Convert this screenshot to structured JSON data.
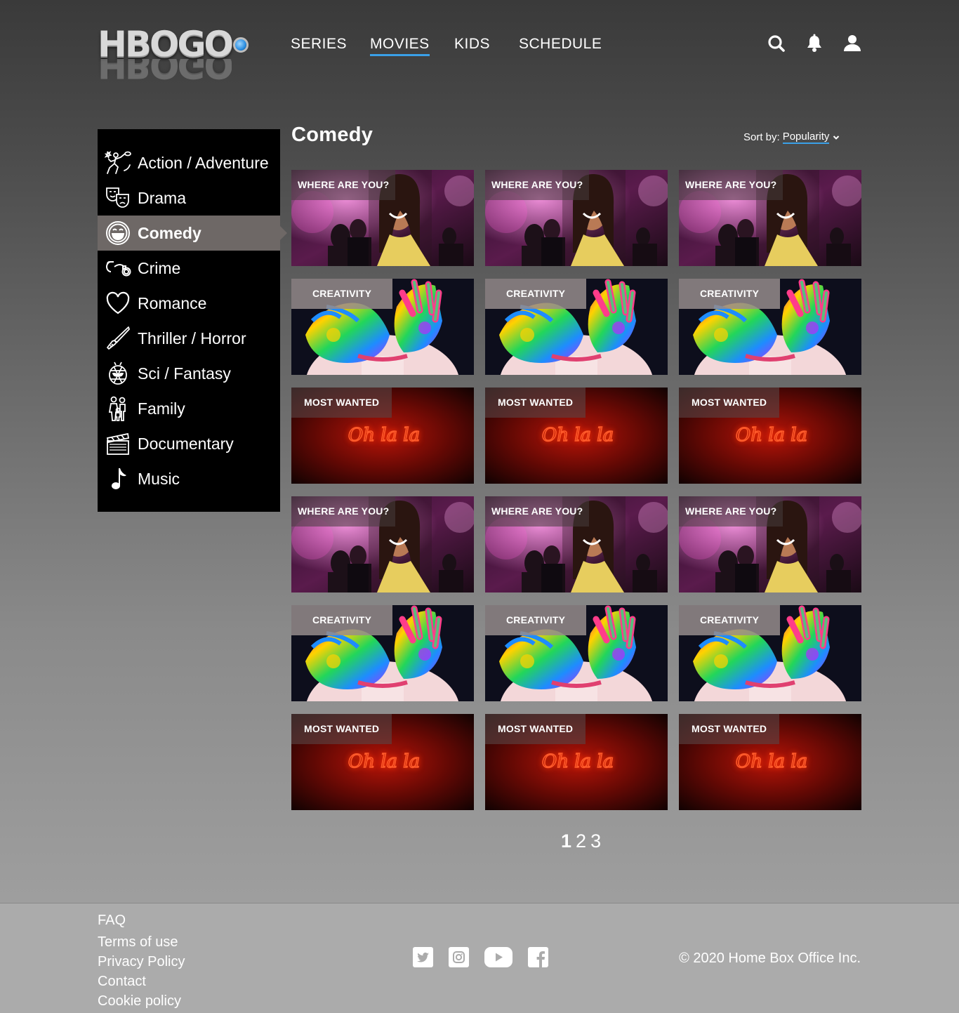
{
  "brand": {
    "logo_text_1": "HBO",
    "logo_text_2": "GO"
  },
  "nav": {
    "series": "SERIES",
    "movies": "MOVIES",
    "kids": "KIDS",
    "schedule": "SCHEDULE",
    "active": "MOVIES"
  },
  "header_icons": [
    "search-icon",
    "bell-icon",
    "user-icon"
  ],
  "sidebar": {
    "items": [
      {
        "label": "Action / Adventure",
        "icon": "action-icon"
      },
      {
        "label": "Drama",
        "icon": "drama-masks-icon"
      },
      {
        "label": "Comedy",
        "icon": "laughing-face-icon",
        "active": true
      },
      {
        "label": "Crime",
        "icon": "handcuffs-icon"
      },
      {
        "label": "Romance",
        "icon": "heart-icon"
      },
      {
        "label": "Thriller / Horror",
        "icon": "knife-icon"
      },
      {
        "label": "Sci / Fantasy",
        "icon": "alien-icon"
      },
      {
        "label": "Family",
        "icon": "family-icon"
      },
      {
        "label": "Documentary",
        "icon": "clapperboard-icon"
      },
      {
        "label": "Music",
        "icon": "music-note-icon"
      }
    ]
  },
  "main": {
    "title": "Comedy",
    "sort_label": "Sort by:",
    "sort_value": "Popularity",
    "cards": [
      {
        "tag": "WHERE ARE YOU?"
      },
      {
        "tag": "WHERE ARE YOU?"
      },
      {
        "tag": "WHERE ARE YOU?"
      },
      {
        "tag": "CREATIVITY"
      },
      {
        "tag": "CREATIVITY"
      },
      {
        "tag": "CREATIVITY"
      },
      {
        "tag": "MOST WANTED",
        "neon": "Oh la la"
      },
      {
        "tag": "MOST WANTED",
        "neon": "Oh la la"
      },
      {
        "tag": "MOST WANTED",
        "neon": "Oh la la"
      },
      {
        "tag": "WHERE ARE YOU?"
      },
      {
        "tag": "WHERE ARE YOU?"
      },
      {
        "tag": "WHERE ARE YOU?"
      },
      {
        "tag": "CREATIVITY"
      },
      {
        "tag": "CREATIVITY"
      },
      {
        "tag": "CREATIVITY"
      },
      {
        "tag": "MOST WANTED",
        "neon": "Oh la la"
      },
      {
        "tag": "MOST WANTED",
        "neon": "Oh la la"
      },
      {
        "tag": "MOST WANTED",
        "neon": "Oh la la"
      }
    ],
    "pages": [
      "1",
      "2",
      "3"
    ],
    "current_page": "1"
  },
  "footer": {
    "links": [
      "FAQ",
      "Terms of use",
      "Privacy Policy",
      "Contact",
      "Cookie policy"
    ],
    "social": [
      "twitter-icon",
      "instagram-icon",
      "youtube-icon",
      "facebook-icon"
    ],
    "copyright": "© 2020 Home Box Office Inc."
  },
  "colors": {
    "accent": "#3aa0e8",
    "sidebar_bg": "#000000",
    "active_item_bg": "#6e6866",
    "footer_bg": "#ababab"
  }
}
